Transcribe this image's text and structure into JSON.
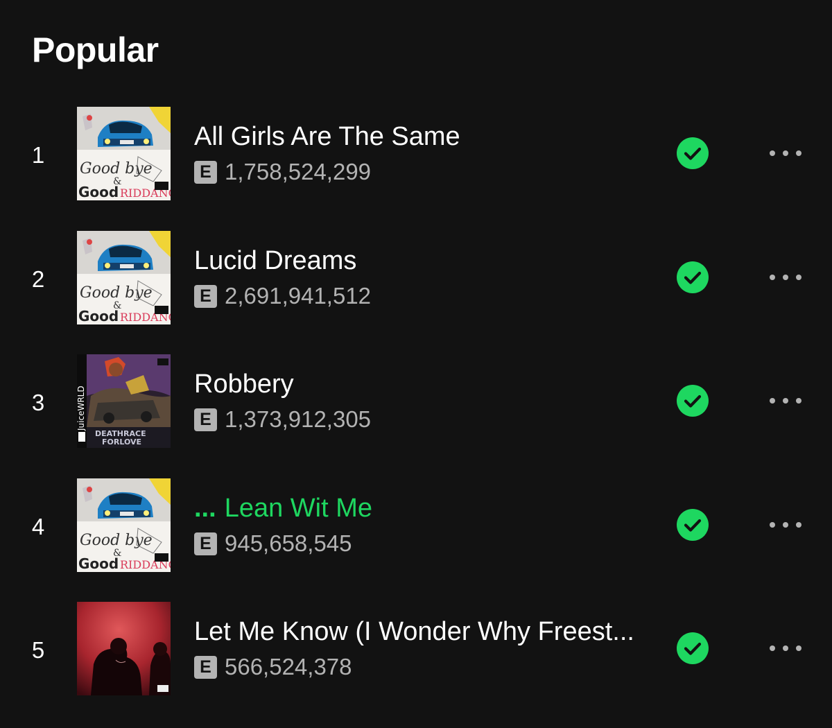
{
  "section": {
    "title": "Popular"
  },
  "colors": {
    "accent": "#1ed760",
    "background": "#121212",
    "secondary_text": "#b3b3b3"
  },
  "tracks": [
    {
      "rank": "1",
      "title": "All Girls Are The Same",
      "explicit": "E",
      "plays": "1,758,524,299",
      "cover": "goodbye-good-riddance-cover",
      "saved": true,
      "playing": false
    },
    {
      "rank": "2",
      "title": "Lucid Dreams",
      "explicit": "E",
      "plays": "2,691,941,512",
      "cover": "goodbye-good-riddance-cover",
      "saved": true,
      "playing": false
    },
    {
      "rank": "3",
      "title": "Robbery",
      "explicit": "E",
      "plays": "1,373,912,305",
      "cover": "death-race-for-love-cover",
      "saved": true,
      "playing": false
    },
    {
      "rank": "4",
      "title": "Lean Wit Me",
      "playing_indicator": "...",
      "explicit": "E",
      "plays": "945,658,545",
      "cover": "goodbye-good-riddance-cover",
      "saved": true,
      "playing": true
    },
    {
      "rank": "5",
      "title": "Let Me Know (I Wonder Why Freest...",
      "explicit": "E",
      "plays": "566,524,378",
      "cover": "let-me-know-cover",
      "saved": true,
      "playing": false
    }
  ]
}
